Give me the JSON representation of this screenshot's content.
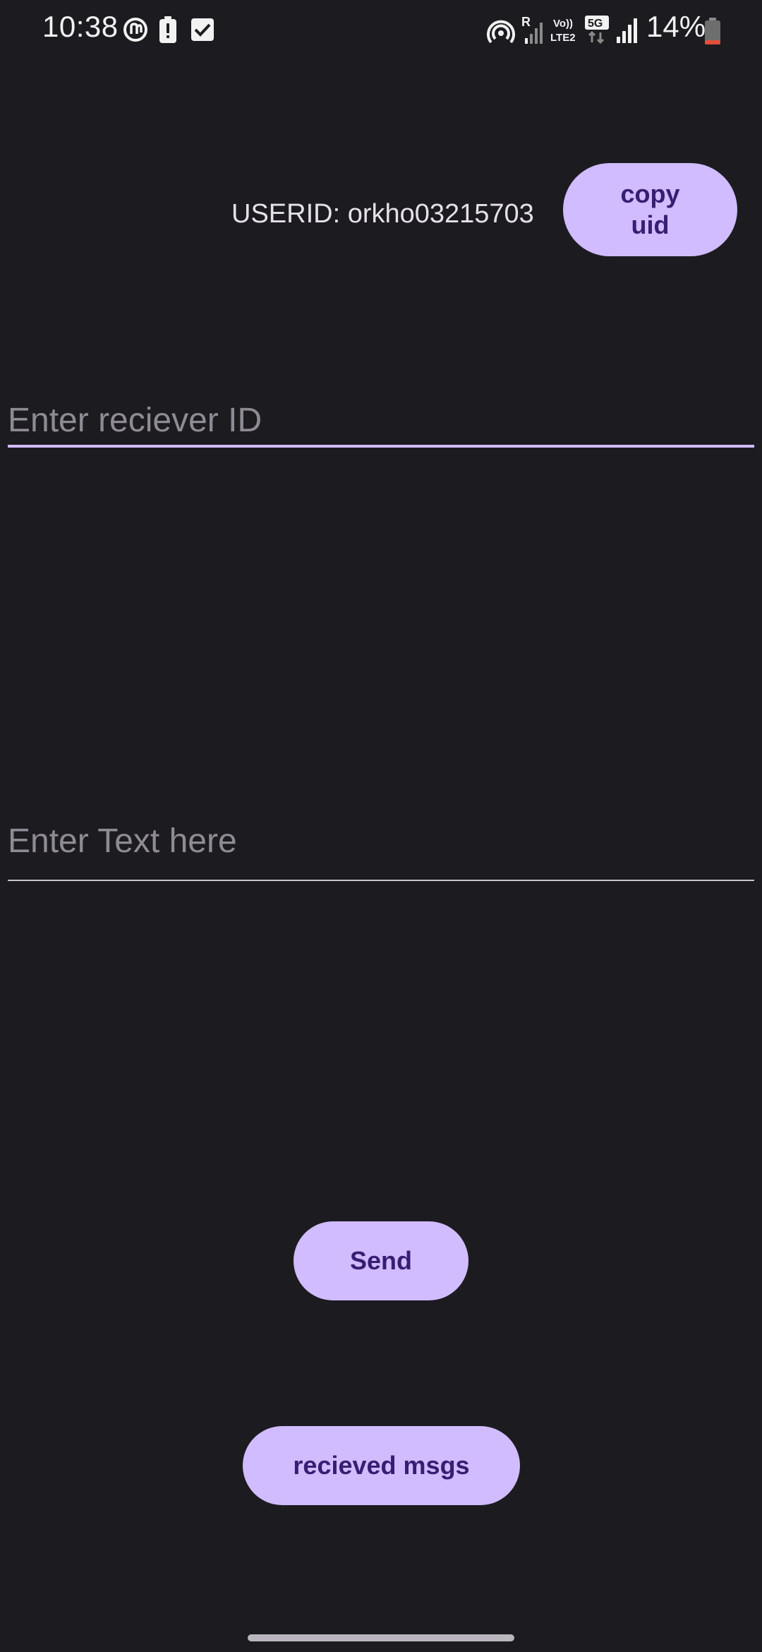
{
  "status_bar": {
    "time": "10:38",
    "battery_percent": "14%",
    "battery_level": 0.14,
    "network_label": "5G",
    "volte_label": "Vo)) LTE2",
    "roaming_label": "R",
    "left_icons": [
      "sync-app-icon",
      "battery-alert-icon",
      "checkbox-notification-icon"
    ],
    "right_icons": [
      "hotspot-icon",
      "roaming-signal-icon",
      "volte-icon",
      "5g-data-icon",
      "signal-icon",
      "battery-icon"
    ]
  },
  "user": {
    "userid_text": "USERID: orkho03215703",
    "copy_button_label": "copy uid"
  },
  "form": {
    "receiver_placeholder": "Enter reciever ID",
    "receiver_value": "",
    "message_placeholder": "Enter Text here",
    "message_value": ""
  },
  "actions": {
    "send_label": "Send",
    "received_label": "recieved msgs"
  },
  "colors": {
    "background": "#1c1b20",
    "button_fill": "#d0bcff",
    "button_text": "#381e72",
    "focused_underline": "#d0bcff",
    "battery_low": "#e2503a"
  }
}
